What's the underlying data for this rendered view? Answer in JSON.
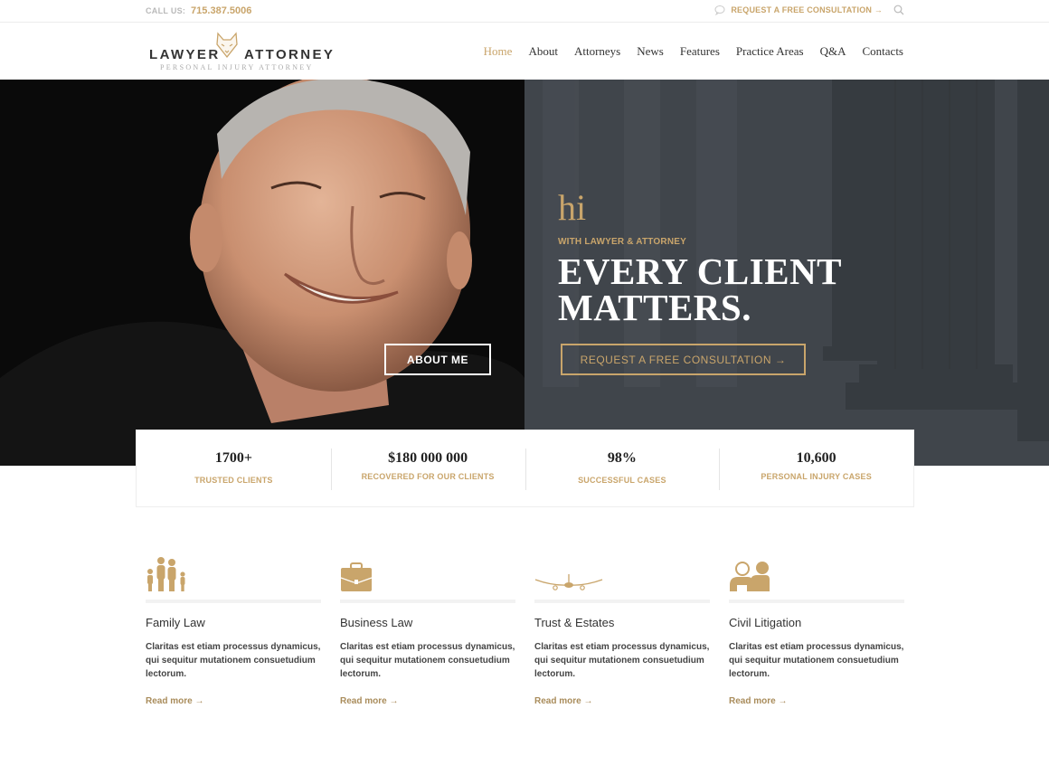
{
  "topbar": {
    "call_label": "CALL US:",
    "phone": "715.387.5006",
    "request_link": "REQUEST A FREE CONSULTATION →",
    "icons": [
      "chat-icon",
      "search-icon"
    ]
  },
  "header": {
    "logo": {
      "word_left": "LAWYER",
      "word_right": "ATTORNEY",
      "tagline": "PERSONAL INJURY ATTORNEY",
      "emblem": "fox-icon"
    },
    "nav": [
      {
        "label": "Home",
        "active": true
      },
      {
        "label": "About"
      },
      {
        "label": "Attorneys"
      },
      {
        "label": "News"
      },
      {
        "label": "Features"
      },
      {
        "label": "Practice Areas"
      },
      {
        "label": "Q&A"
      },
      {
        "label": "Contacts"
      }
    ]
  },
  "hero": {
    "greeting": "hi",
    "subtitle": "WITH LAWYER & ATTORNEY",
    "headline_line1": "EVERY CLIENT",
    "headline_line2": "MATTERS.",
    "about_button": "ABOUT ME",
    "consult_button": "REQUEST A FREE CONSULTATION →"
  },
  "stats": [
    {
      "value": "1700+",
      "label": "TRUSTED CLIENTS"
    },
    {
      "value": "$180 000 000",
      "label": "RECOVERED FOR OUR CLIENTS"
    },
    {
      "value": "98%",
      "label": "SUCCESSFUL CASES"
    },
    {
      "value": "10,600",
      "label": "PERSONAL INJURY CASES"
    }
  ],
  "areas": [
    {
      "icon": "family-icon",
      "title": "Family Law",
      "desc": "Claritas est etiam processus dynamicus, qui sequitur mutationem consuetudium lectorum.",
      "link": "Read more →"
    },
    {
      "icon": "briefcase-icon",
      "title": "Business Law",
      "desc": "Claritas est etiam processus dynamicus, qui sequitur mutationem consuetudium lectorum.",
      "link": "Read more →"
    },
    {
      "icon": "airplane-icon",
      "title": "Trust & Estates",
      "desc": "Claritas est etiam processus dynamicus, qui sequitur mutationem consuetudium lectorum.",
      "link": "Read more →"
    },
    {
      "icon": "users-icon",
      "title": "Civil Litigation",
      "desc": "Claritas est etiam processus dynamicus, qui sequitur mutationem consuetudium lectorum.",
      "link": "Read more →"
    }
  ],
  "colors": {
    "accent_gold": "#c9a56b",
    "hero_dark": "#0b0b0b",
    "hero_slate": "#41464c",
    "text_dark": "#333333"
  }
}
